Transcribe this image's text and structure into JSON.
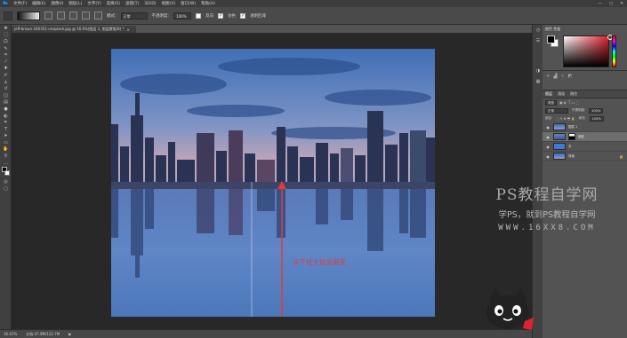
{
  "menubar": {
    "logo": "Ps",
    "items": [
      "文件(F)",
      "编辑(E)",
      "图像(I)",
      "图层(L)",
      "文字(Y)",
      "选择(S)",
      "滤镜(T)",
      "3D(D)",
      "视图(V)",
      "窗口(W)",
      "帮助(H)"
    ],
    "controls": [
      "—",
      "▢",
      "✕"
    ]
  },
  "options": {
    "mode_label": "模式:",
    "mode_value": "正常",
    "opacity_label": "不透明度:",
    "opacity_value": "100%",
    "reverse_label": "反向",
    "dither_label": "仿色",
    "transparency_label": "透明区域"
  },
  "document": {
    "tab_title": "jeff-brown-240351-unsplash.jpg @ 16.6%(图层 1, 图层蒙版/8) *",
    "close": "×"
  },
  "status": {
    "zoom": "16.67%",
    "doc": "文档:47.9M/122.7M",
    "arrow": "▶"
  },
  "canvas": {
    "annotation": "从下往上拉出渐变"
  },
  "colors": {
    "annotation_red": "#e53935",
    "accent": "#e0222c"
  },
  "color_panel": {
    "tab": "颜色  色板"
  },
  "layers_panel": {
    "tabs": [
      "图层",
      "通道",
      "路径"
    ],
    "kind_label": "类型",
    "blend_value": "正常",
    "opacity_label": "不透明度:",
    "opacity_value": "100%",
    "lock_label": "锁定:",
    "fill_label": "填充:",
    "fill_value": "100%",
    "layers": [
      {
        "name": "图层 1",
        "selected": false,
        "thumb": "sky",
        "mask": false
      },
      {
        "name": "倒影",
        "selected": true,
        "thumb": "reflect",
        "mask": true
      },
      {
        "name": "天",
        "selected": false,
        "thumb": "blue",
        "mask": false
      },
      {
        "name": "背景",
        "selected": false,
        "thumb": "sky",
        "mask": false,
        "locked": true
      }
    ]
  },
  "watermark": {
    "line1": "PS教程自学网",
    "line2": "学PS，就到PS教程自学网",
    "line3": "WWW.16XX8.COM"
  }
}
